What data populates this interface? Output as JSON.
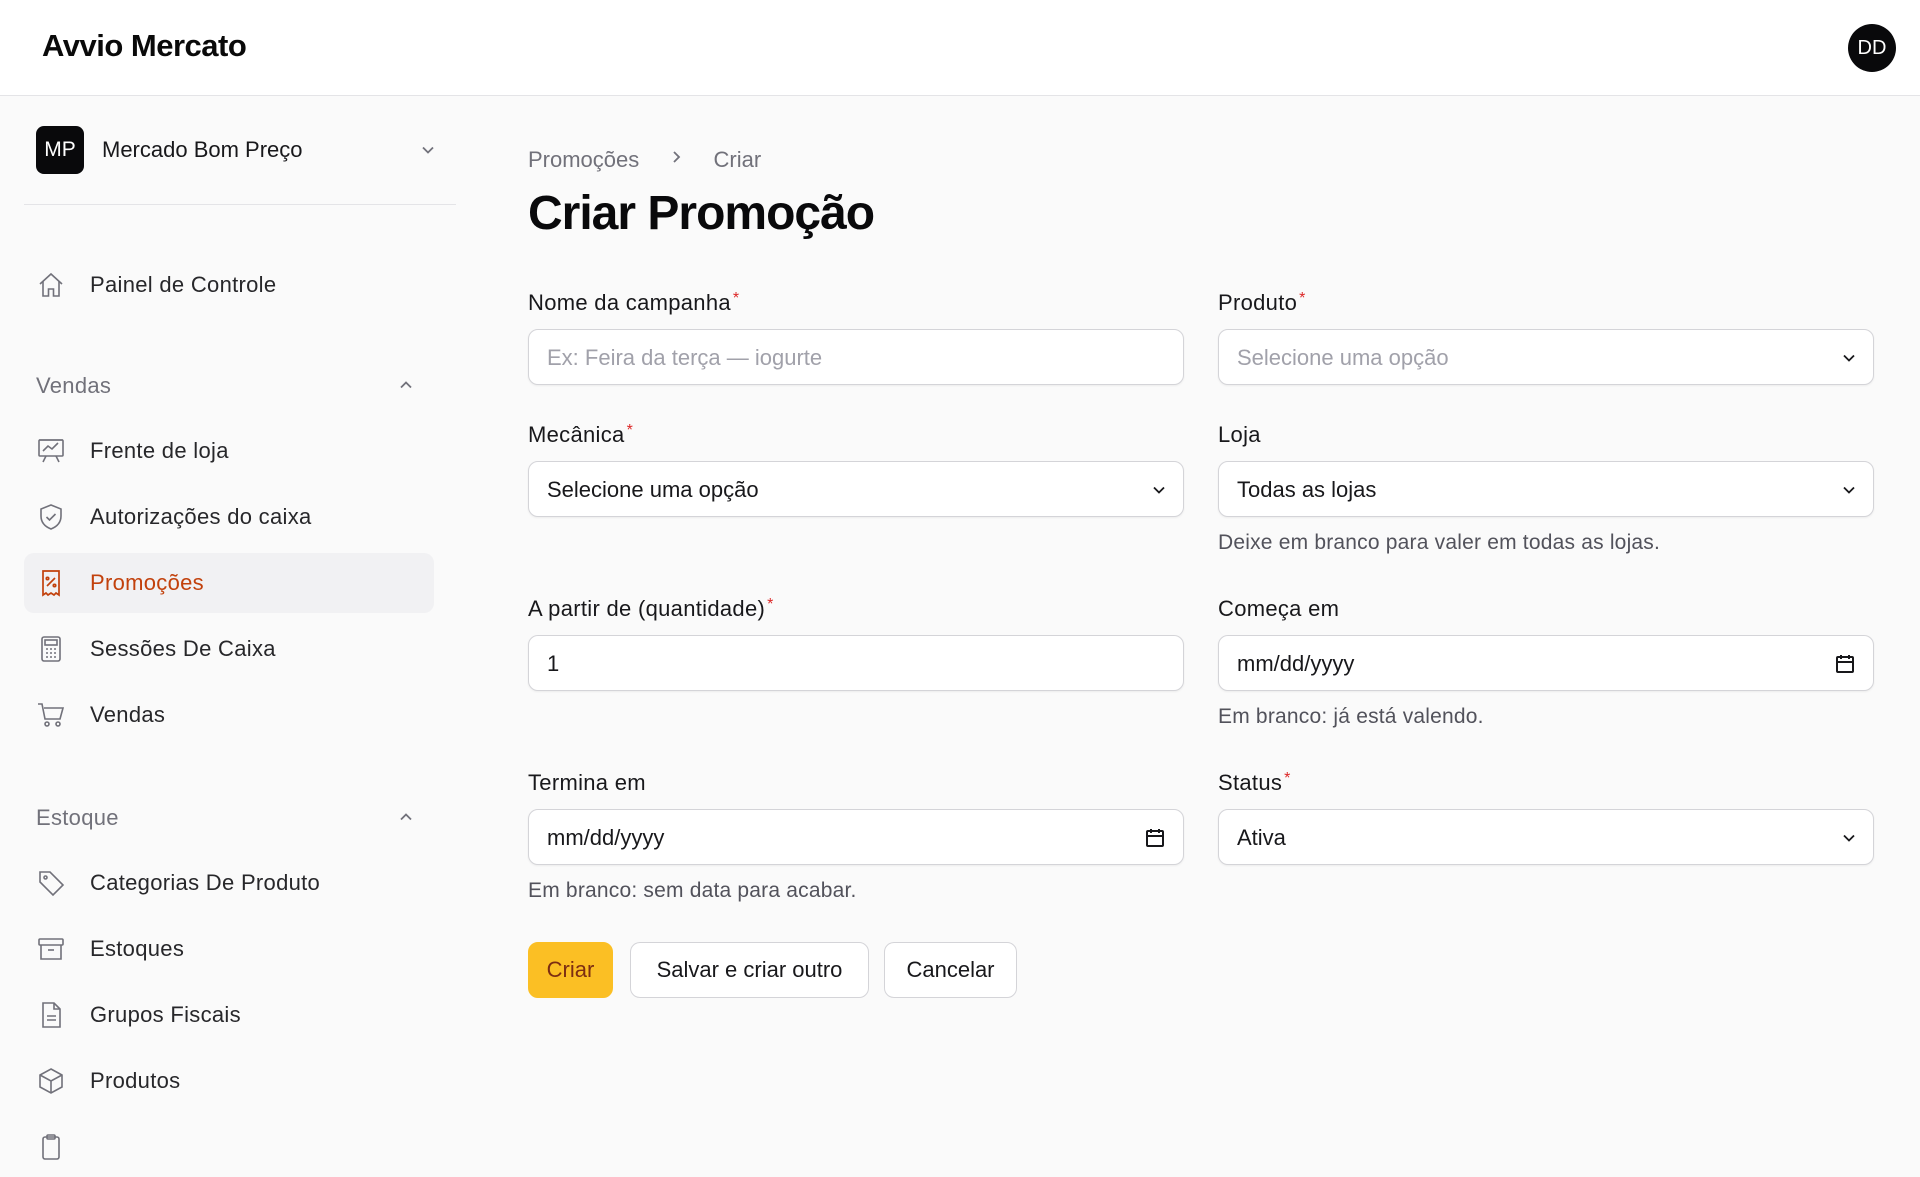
{
  "app": {
    "title": "Avvio Mercato",
    "user_initials": "DD"
  },
  "tenant": {
    "initials": "MP",
    "name": "Mercado Bom Preço"
  },
  "sidebar": {
    "dashboard": "Painel de Controle",
    "groups": [
      {
        "label": "Vendas",
        "items": [
          "Frente de loja",
          "Autorizações do caixa",
          "Promoções",
          "Sessões De Caixa",
          "Vendas"
        ]
      },
      {
        "label": "Estoque",
        "items": [
          "Categorias De Produto",
          "Estoques",
          "Grupos Fiscais",
          "Produtos"
        ]
      }
    ],
    "active_item": "Promoções"
  },
  "breadcrumb": {
    "parent": "Promoções",
    "current": "Criar"
  },
  "page": {
    "title": "Criar Promoção"
  },
  "form": {
    "campaign_name": {
      "label": "Nome da campanha",
      "placeholder": "Ex: Feira da terça — iogurte",
      "value": ""
    },
    "product": {
      "label": "Produto",
      "placeholder": "Selecione uma opção"
    },
    "mechanic": {
      "label": "Mecânica",
      "value": "Selecione uma opção"
    },
    "store": {
      "label": "Loja",
      "value": "Todas as lojas",
      "help": "Deixe em branco para valer em todas as lojas."
    },
    "min_quantity": {
      "label": "A partir de (quantidade)",
      "value": "1"
    },
    "starts_at": {
      "label": "Começa em",
      "value": "mm/dd/yyyy",
      "help": "Em branco: já está valendo."
    },
    "ends_at": {
      "label": "Termina em",
      "value": "mm/dd/yyyy",
      "help": "Em branco: sem data para acabar."
    },
    "status": {
      "label": "Status",
      "value": "Ativa"
    },
    "required_marker": "*"
  },
  "actions": {
    "create": "Criar",
    "save_and_new": "Salvar e criar outro",
    "cancel": "Cancelar"
  },
  "colors": {
    "accent": "#fbbf24",
    "active_nav": "#c2410c",
    "required": "#dc2626"
  }
}
